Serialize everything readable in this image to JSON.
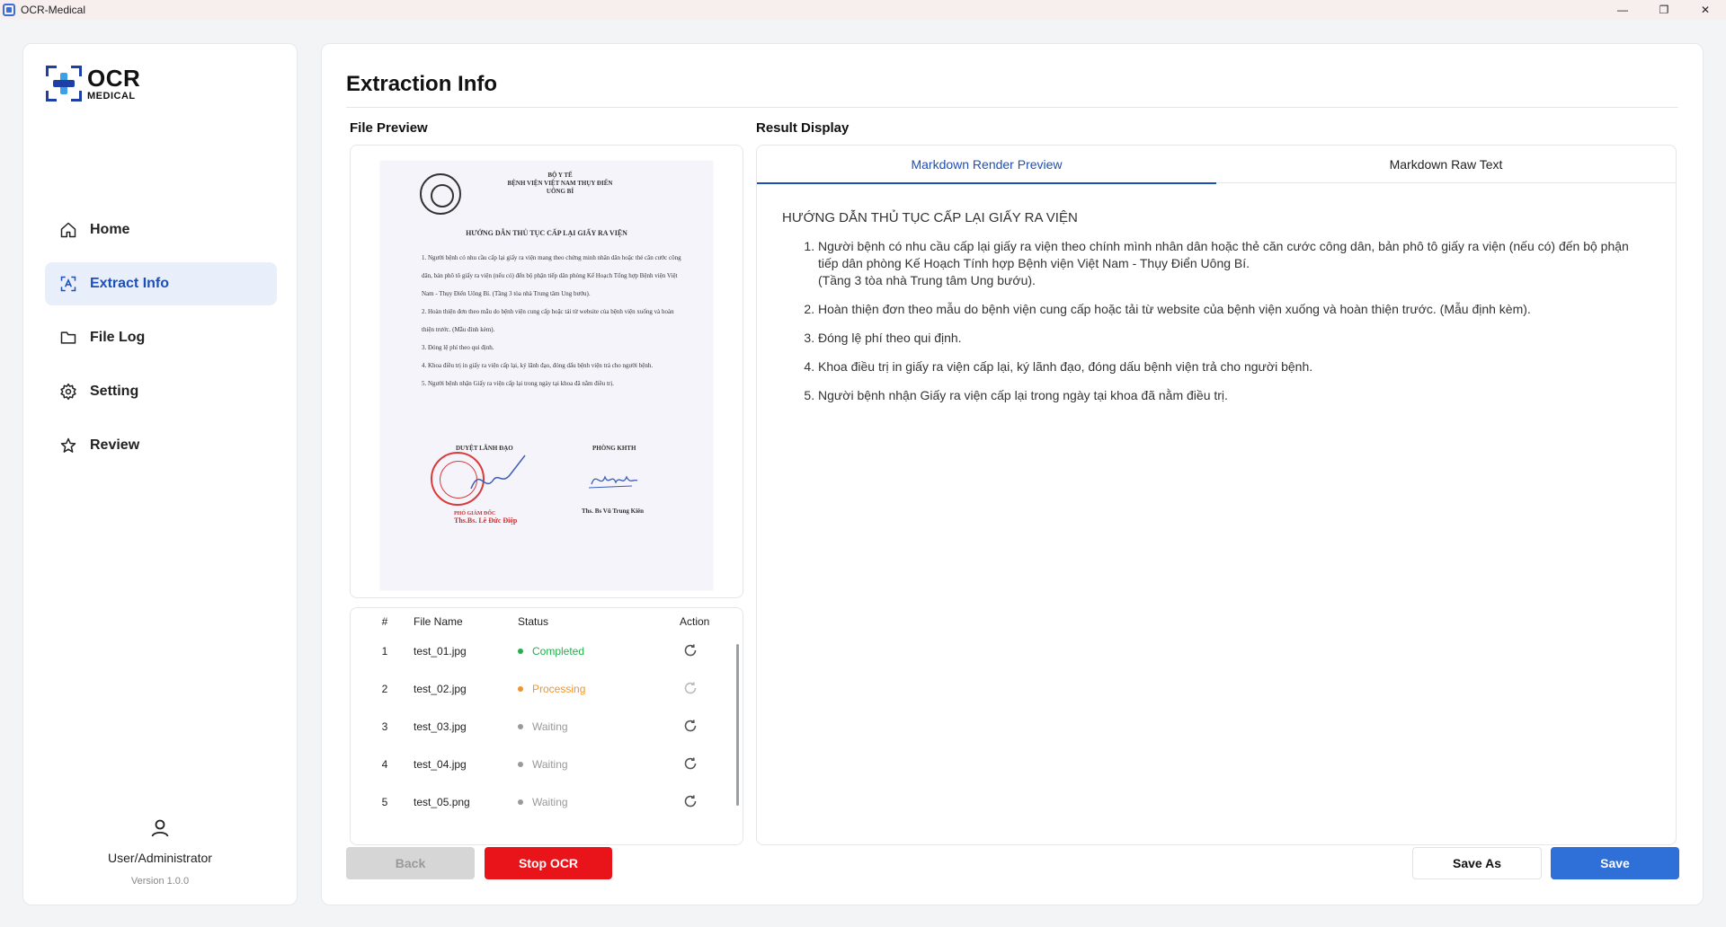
{
  "window": {
    "title": "OCR-Medical",
    "controls": {
      "minimize": "—",
      "maximize": "❐",
      "close": "✕"
    }
  },
  "logo": {
    "line1": "OCR",
    "line2": "MEDICAL"
  },
  "sidebar": {
    "items": [
      {
        "label": "Home",
        "icon": "home-icon",
        "active": false
      },
      {
        "label": "Extract Info",
        "icon": "scan-icon",
        "active": true
      },
      {
        "label": "File Log",
        "icon": "folder-icon",
        "active": false
      },
      {
        "label": "Setting",
        "icon": "gear-icon",
        "active": false
      },
      {
        "label": "Review",
        "icon": "star-icon",
        "active": false
      }
    ],
    "user": "User/Administrator",
    "version": "Version 1.0.0"
  },
  "main": {
    "title": "Extraction Info",
    "file_preview_title": "File Preview",
    "result_title": "Result Display"
  },
  "document": {
    "header_1": "BỘ Y TẾ",
    "header_2": "BỆNH VIỆN VIỆT NAM THỤY ĐIỂN",
    "header_3": "UÔNG BÍ",
    "title": "HƯỚNG DẪN THỦ TỤC CẤP LẠI GIẤY RA VIỆN",
    "para_1": "1. Người bệnh có nhu cầu cấp lại giấy ra viện mang theo chứng minh nhân dân hoặc thẻ căn cước công dân, bản phô tô giấy ra viện (nếu có) đến bộ phận tiếp dân phòng Kế Hoạch Tổng hợp Bệnh viện Việt Nam - Thụy Điển Uông Bí. (Tầng 3 tòa nhà Trung tâm Ung bướu).",
    "para_2": "2. Hoàn thiện đơn theo mẫu do bệnh viện cung cấp hoặc tải từ website của bệnh viện xuống và hoàn thiện trước. (Mẫu đính kèm).",
    "para_3": "3. Đóng lệ phí theo qui định.",
    "para_4": "4. Khoa điều trị in giấy ra viện cấp lại, ký lãnh đạo, đóng dấu bệnh viện trả cho người bệnh.",
    "para_5": "5. Người bệnh nhận Giấy ra viện cấp lại trong ngày tại khoa đã nằm điều trị.",
    "sign_left": "DUYỆT LÃNH ĐẠO",
    "sign_right": "PHÒNG KHTH",
    "name_left_role": "PHÓ GIÁM ĐỐC",
    "name_left": "Ths.Bs. Lê Đức Điệp",
    "name_right": "Ths. Bs Vũ Trung Kiên"
  },
  "file_table": {
    "headers": {
      "num": "#",
      "name": "File Name",
      "status": "Status",
      "action": "Action"
    },
    "rows": [
      {
        "num": "1",
        "name": "test_01.jpg",
        "status": "Completed"
      },
      {
        "num": "2",
        "name": "test_02.jpg",
        "status": "Processing"
      },
      {
        "num": "3",
        "name": "test_03.jpg",
        "status": "Waiting"
      },
      {
        "num": "4",
        "name": "test_04.jpg",
        "status": "Waiting"
      },
      {
        "num": "5",
        "name": "test_05.png",
        "status": "Waiting"
      }
    ]
  },
  "result": {
    "tabs": [
      {
        "label": "Markdown Render Preview",
        "active": true
      },
      {
        "label": "Markdown Raw Text",
        "active": false
      }
    ],
    "heading": "HƯỚNG DẪN THỦ TỤC CẤP LẠI GIẤY RA VIỆN",
    "items": [
      {
        "text": "Người bệnh có nhu cầu cấp lại giấy ra viện theo chính mình nhân dân hoặc thẻ căn cước công dân, bản phô tô giấy ra viện (nếu có) đến bộ phận tiếp dân phòng Kế Hoạch Tính hợp Bệnh viện Việt Nam - Thụy Điển Uông Bí.",
        "sub": "(Tầng 3 tòa nhà Trung tâm Ung bướu)."
      },
      {
        "text": "Hoàn thiện đơn theo mẫu do bệnh viện cung cấp hoặc tải từ website của bệnh viện xuống và hoàn thiện trước. (Mẫu định kèm)."
      },
      {
        "text": "Đóng lệ phí theo qui định."
      },
      {
        "text": "Khoa điều trị in giấy ra viện cấp lại, ký lãnh đạo, đóng dấu bệnh viện trả cho người bệnh."
      },
      {
        "text": "Người bệnh nhận Giấy ra viện cấp lại trong ngày tại khoa đã nằm điều trị."
      }
    ]
  },
  "buttons": {
    "back": "Back",
    "stop": "Stop OCR",
    "save_as": "Save As",
    "save": "Save"
  },
  "colors": {
    "accent": "#1d4fb8",
    "stop": "#e8141a",
    "save": "#2e6fd8",
    "completed": "#22b04b",
    "processing": "#f2942b",
    "waiting": "#999999"
  }
}
